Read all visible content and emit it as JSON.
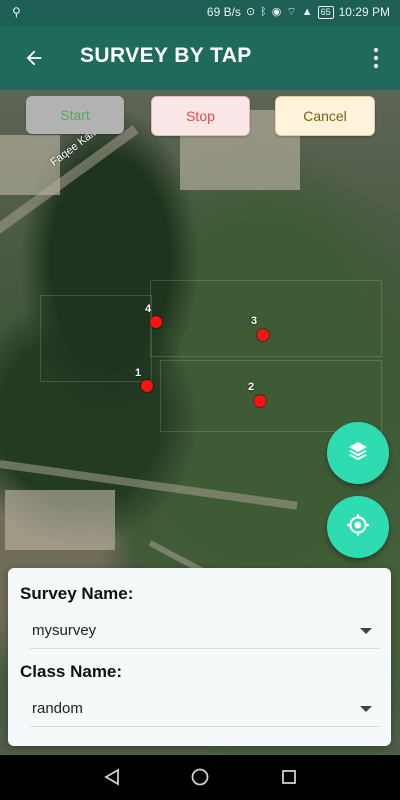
{
  "status_bar": {
    "left_icon": "usb-icon",
    "speed": "69 B/s",
    "battery": "65",
    "time": "10:29 PM"
  },
  "app_bar": {
    "title": "SURVEY BY TAP",
    "back_icon": "back-arrow-icon",
    "menu_icon": "more-vert-icon"
  },
  "controls": {
    "start": "Start",
    "stop": "Stop",
    "cancel": "Cancel"
  },
  "map": {
    "road_label": "Faqee Kalay R",
    "points": [
      {
        "label": "1"
      },
      {
        "label": "2"
      },
      {
        "label": "3"
      },
      {
        "label": "4"
      }
    ]
  },
  "fab": {
    "layers_icon": "layers-icon",
    "locate_icon": "my-location-icon"
  },
  "form": {
    "survey_label": "Survey Name:",
    "survey_value": "mysurvey",
    "class_label": "Class Name:",
    "class_value": "random"
  },
  "colors": {
    "primary": "#206a5c",
    "accent": "#2fdbb0",
    "point": "#ff1111"
  }
}
